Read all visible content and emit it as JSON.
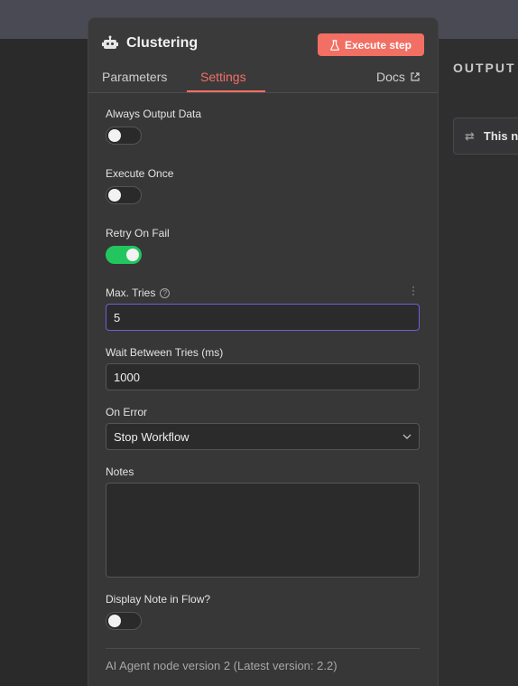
{
  "output_panel": {
    "title": "OUTPUT",
    "message": "This n"
  },
  "node": {
    "title": "Clustering",
    "icon": "robot-icon",
    "execute_label": "Execute step"
  },
  "tabs": [
    {
      "label": "Parameters"
    },
    {
      "label": "Settings"
    },
    {
      "label": "Docs"
    }
  ],
  "settings": {
    "always_output": {
      "label": "Always Output Data",
      "enabled": false
    },
    "execute_once": {
      "label": "Execute Once",
      "enabled": false
    },
    "retry_on_fail": {
      "label": "Retry On Fail",
      "enabled": true
    },
    "max_tries": {
      "label": "Max. Tries",
      "value": "5"
    },
    "wait_between": {
      "label": "Wait Between Tries (ms)",
      "value": "1000"
    },
    "on_error": {
      "label": "On Error",
      "value": "Stop Workflow"
    },
    "notes": {
      "label": "Notes",
      "value": ""
    },
    "display_note": {
      "label": "Display Note in Flow?",
      "enabled": false
    }
  },
  "footer": {
    "version_note": "AI Agent node version 2 (Latest version: 2.2)"
  },
  "colors": {
    "accent": "#f27063",
    "toggle_on": "#22c55e",
    "focus_border": "#6b5fd6"
  }
}
